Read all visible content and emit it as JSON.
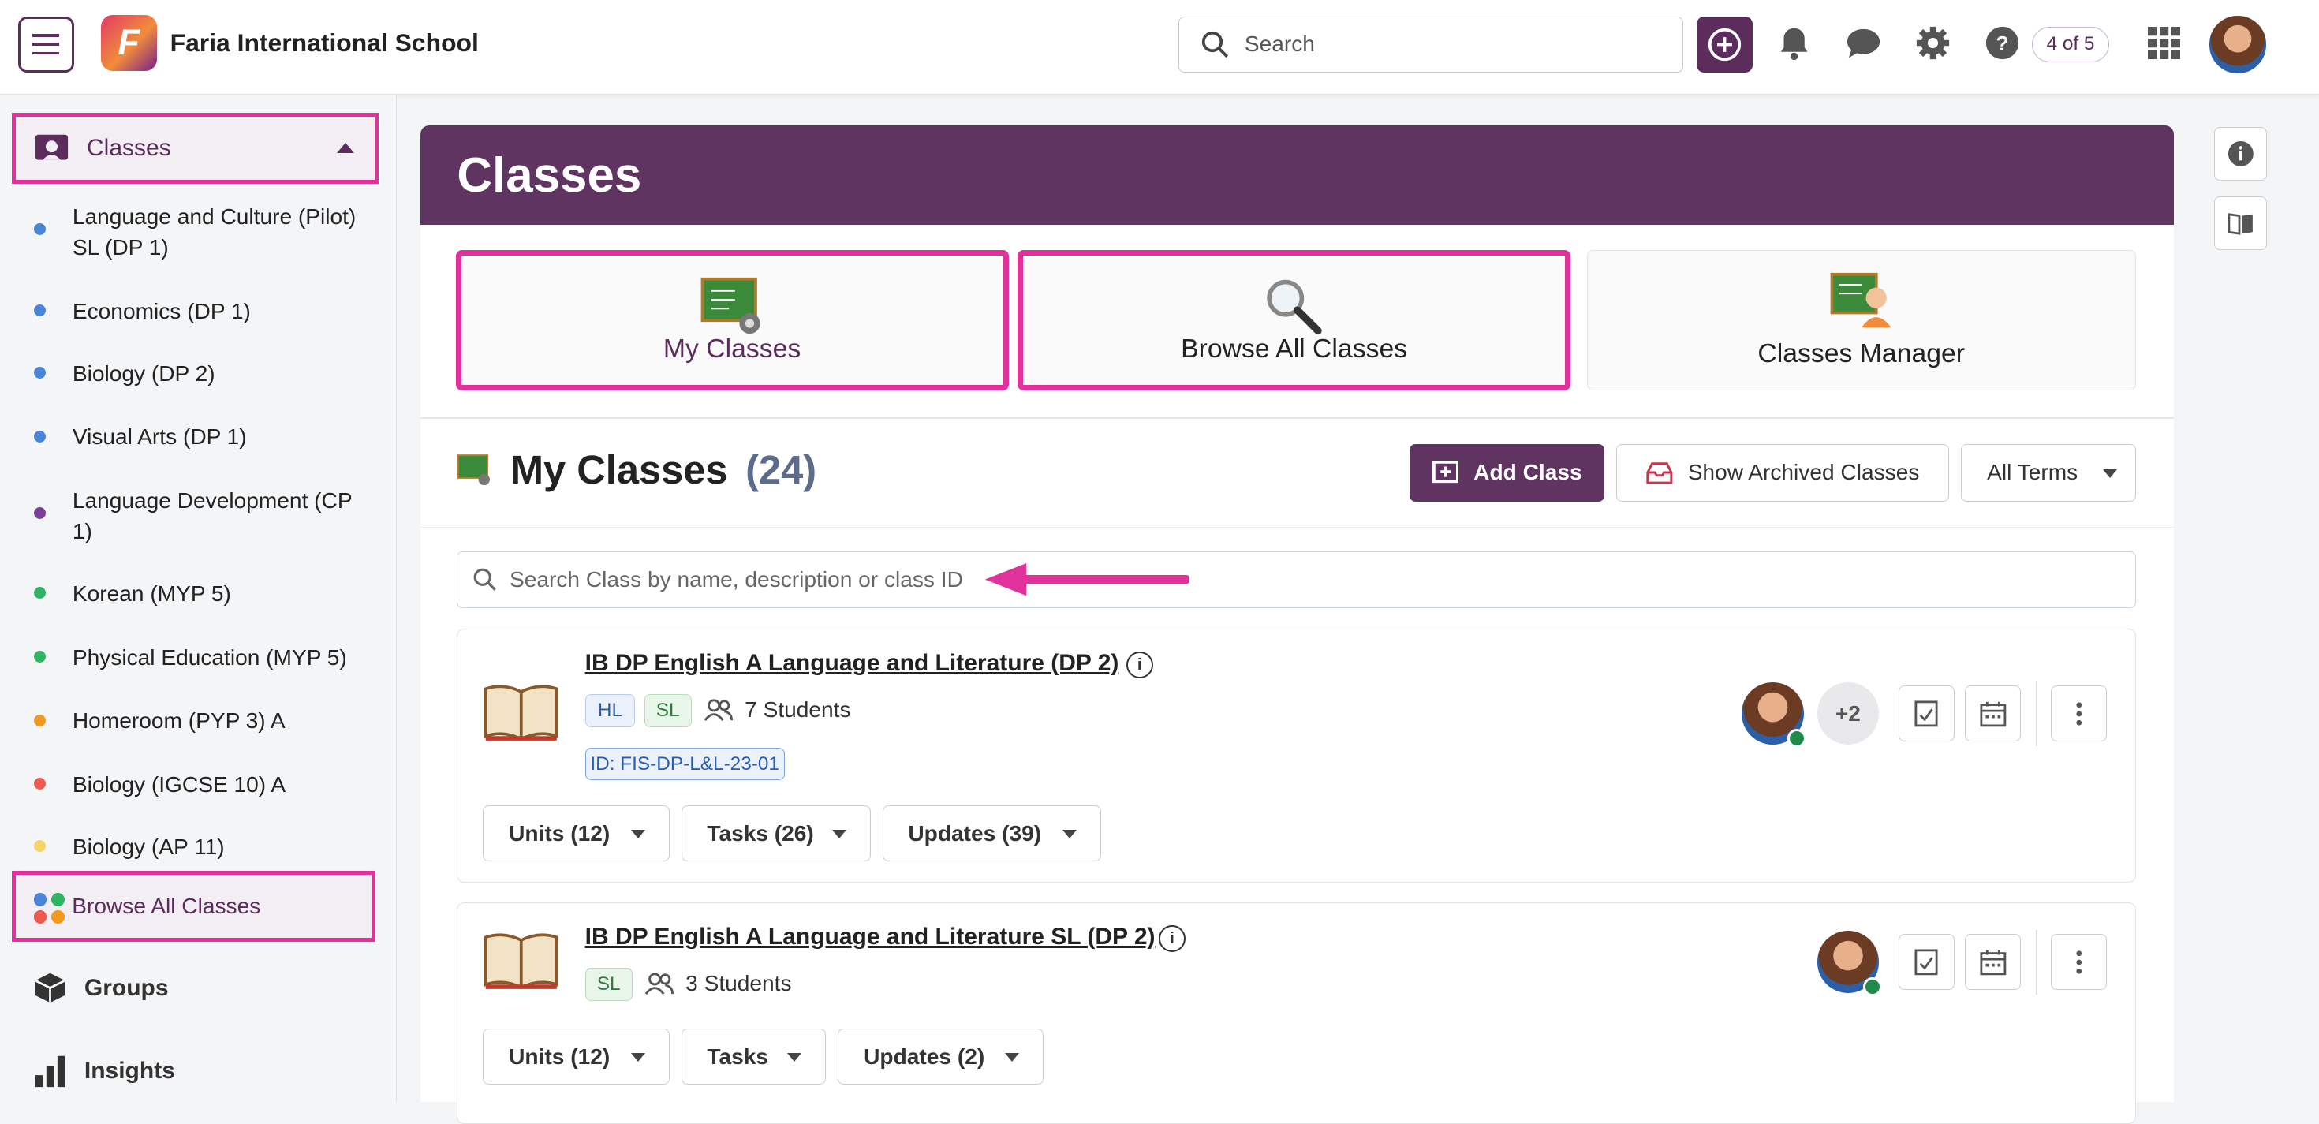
{
  "topbar": {
    "school_name": "Faria International School",
    "logo_letter": "F",
    "search_placeholder": "Search",
    "page_counter": "4 of 5"
  },
  "sidebar": {
    "section_label": "Classes",
    "items": [
      {
        "label": "Language and Culture (Pilot) SL (DP 1)",
        "color": "#4a86d8"
      },
      {
        "label": "Economics (DP 1)",
        "color": "#4a86d8"
      },
      {
        "label": "Biology (DP 2)",
        "color": "#4a86d8"
      },
      {
        "label": "Visual Arts (DP 1)",
        "color": "#4a86d8"
      },
      {
        "label": "Language Development (CP 1)",
        "color": "#7b3f9a"
      },
      {
        "label": "Korean (MYP 5)",
        "color": "#2fb562"
      },
      {
        "label": "Physical Education (MYP 5)",
        "color": "#2fb562"
      },
      {
        "label": "Homeroom (PYP 3) A",
        "color": "#f29a1f"
      },
      {
        "label": "Biology (IGCSE 10) A",
        "color": "#ee5a4d"
      },
      {
        "label": "Biology (AP 11)",
        "color": "#f5d56a"
      }
    ],
    "browse_all": "Browse All Classes",
    "groups": "Groups",
    "insights": "Insights"
  },
  "main": {
    "title": "Classes",
    "tiles": {
      "my_classes": "My Classes",
      "browse_all": "Browse All Classes",
      "manager": "Classes Manager"
    },
    "section_title": "My Classes",
    "section_count": "(24)",
    "add_class": "Add Class",
    "show_archived": "Show Archived Classes",
    "terms": "All Terms",
    "class_search_placeholder": "Search Class by name, description or class ID"
  },
  "classes": [
    {
      "name": "IB DP English A Language and Literature (DP 2)",
      "tags": [
        "HL",
        "SL"
      ],
      "students": "7 Students",
      "class_id": "ID: FIS-DP-L&L-23-01",
      "extra_teachers": "+2",
      "units": "Units (12)",
      "tasks": "Tasks (26)",
      "updates": "Updates (39)"
    },
    {
      "name": "IB DP English A Language and Literature SL (DP 2)",
      "tags": [
        "SL"
      ],
      "students": "3 Students",
      "units": "Units (12)",
      "tasks": "Tasks",
      "updates": "Updates (2)"
    }
  ],
  "colors": {
    "brand": "#5f3461",
    "highlight": "#e0329a"
  }
}
